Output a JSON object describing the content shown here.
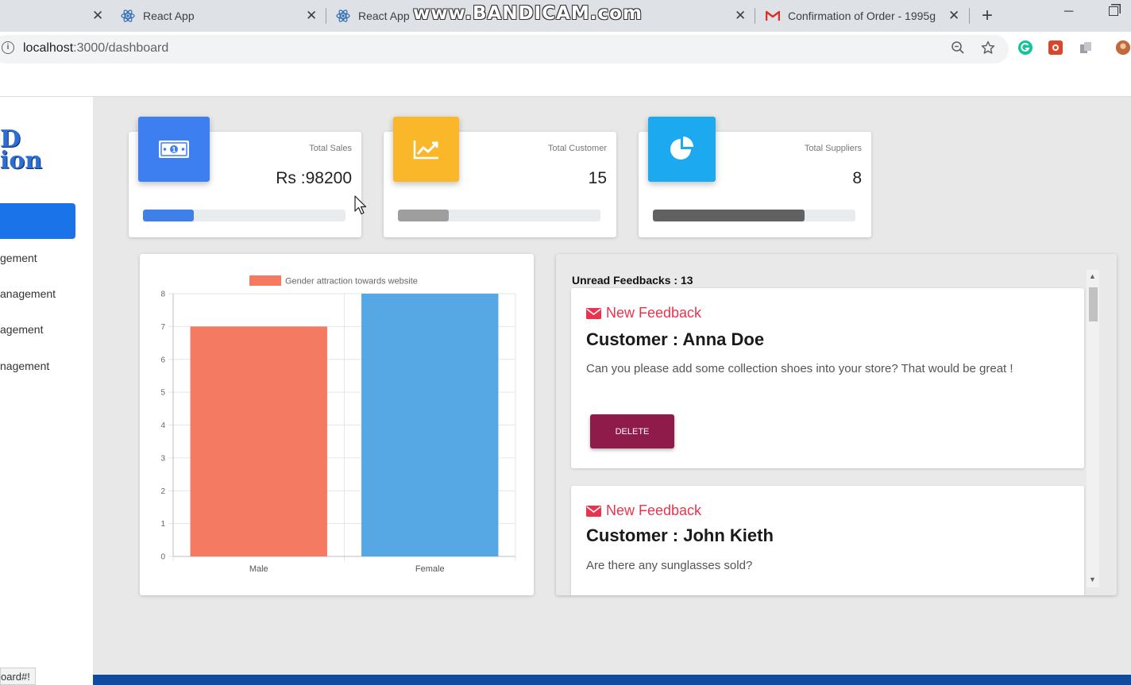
{
  "browser": {
    "tabs": [
      {
        "title": ""
      },
      {
        "title": "React App"
      },
      {
        "title": "React App"
      },
      {
        "title": "Confirmation of Order - 1995g"
      }
    ],
    "watermark": "www.BANDICAM.com",
    "url_host": "localhost",
    "url_path": ":3000/dashboard",
    "status_url": "oard#!"
  },
  "sidebar": {
    "logo_line1": "D",
    "logo_line2": "ion",
    "items": [
      {
        "label": "gement"
      },
      {
        "label": "anagement"
      },
      {
        "label": "agement"
      },
      {
        "label": "nagement"
      }
    ]
  },
  "stats": [
    {
      "label": "Total Sales",
      "value": "Rs :98200",
      "icon": "money-icon",
      "color": "#3d7ff0",
      "bar_color": "#3f80e8",
      "progress": 0.25
    },
    {
      "label": "Total Customer",
      "value": "15",
      "icon": "chart-line-icon",
      "color": "#fbb72a",
      "bar_color": "#9e9e9e",
      "progress": 0.25
    },
    {
      "label": "Total Suppliers",
      "value": "8",
      "icon": "pie-chart-icon",
      "color": "#1da9f0",
      "bar_color": "#616161",
      "progress": 0.75
    }
  ],
  "chart_data": {
    "type": "bar",
    "categories": [
      "Male",
      "Female"
    ],
    "series": [
      {
        "name": "Gender attraction towards website",
        "values": [
          7,
          8
        ]
      }
    ],
    "bar_colors": [
      "#f47b62",
      "#55a8e3"
    ],
    "ylim": [
      0,
      8
    ],
    "yticks": [
      "0",
      "1",
      "2",
      "3",
      "4",
      "5",
      "6",
      "7",
      "8"
    ],
    "grid": true,
    "legend": "top"
  },
  "feedback": {
    "title": "Unread Feedbacks : 13",
    "items": [
      {
        "tag": "New Feedback",
        "customer": "Customer : Anna Doe",
        "message": "Can you please add some collection shoes into your store? That would be great !",
        "delete_label": "DELETE"
      },
      {
        "tag": "New Feedback",
        "customer": "Customer : John Kieth",
        "message": "Are there any sunglasses sold?"
      }
    ]
  },
  "colors": {
    "accent": "#1a73e8",
    "feedback_tag": "#e8344e",
    "delete_button": "#8e1b4a"
  }
}
